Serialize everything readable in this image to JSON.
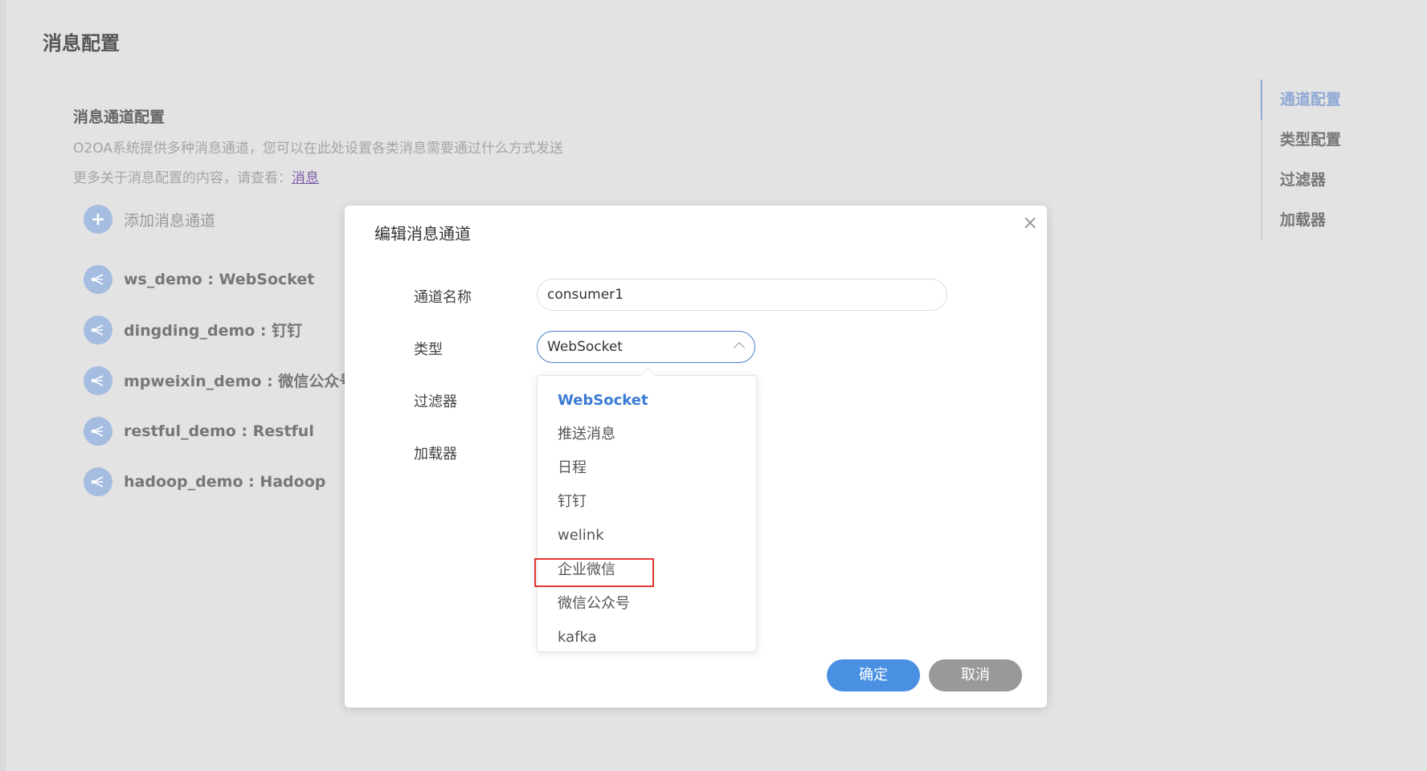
{
  "page": {
    "title": "消息配置"
  },
  "section": {
    "title": "消息通道配置",
    "desc1": "O2OA系统提供多种消息通道，您可以在此处设置各类消息需要通过什么方式发送",
    "desc2_prefix": "更多关于消息配置的内容，请查看：",
    "desc2_link": "消息"
  },
  "add_button": {
    "icon": "+",
    "label": "添加消息通道"
  },
  "channels": [
    {
      "label": "ws_demo : WebSocket",
      "icon": "channel-icon"
    },
    {
      "label": "dingding_demo : 钉钉",
      "icon": "channel-icon"
    },
    {
      "label": "mpweixin_demo : 微信公众号",
      "icon": "channel-icon"
    },
    {
      "label": "restful_demo : Restful",
      "icon": "channel-icon"
    },
    {
      "label": "hadoop_demo : Hadoop",
      "icon": "channel-icon"
    }
  ],
  "right_nav": [
    {
      "label": "通道配置",
      "active": true
    },
    {
      "label": "类型配置",
      "active": false
    },
    {
      "label": "过滤器",
      "active": false
    },
    {
      "label": "加载器",
      "active": false
    }
  ],
  "dialog": {
    "title": "编辑消息通道",
    "close_icon": "×",
    "labels": {
      "name": "通道名称",
      "type": "类型",
      "filter": "过滤器",
      "loader": "加载器"
    },
    "name_value": "consumer1",
    "type_value": "WebSocket",
    "options": [
      "WebSocket",
      "推送消息",
      "日程",
      "钉钉",
      "welink",
      "企业微信",
      "微信公众号",
      "kafka"
    ],
    "selected_option": "WebSocket",
    "highlighted_option": "企业微信",
    "ok_label": "确定",
    "cancel_label": "取消"
  },
  "colors": {
    "accent": "#4a90e2",
    "nav_active": "#8fa8d6",
    "highlight_border": "#e53935",
    "selected_option": "#3a7bd5"
  }
}
